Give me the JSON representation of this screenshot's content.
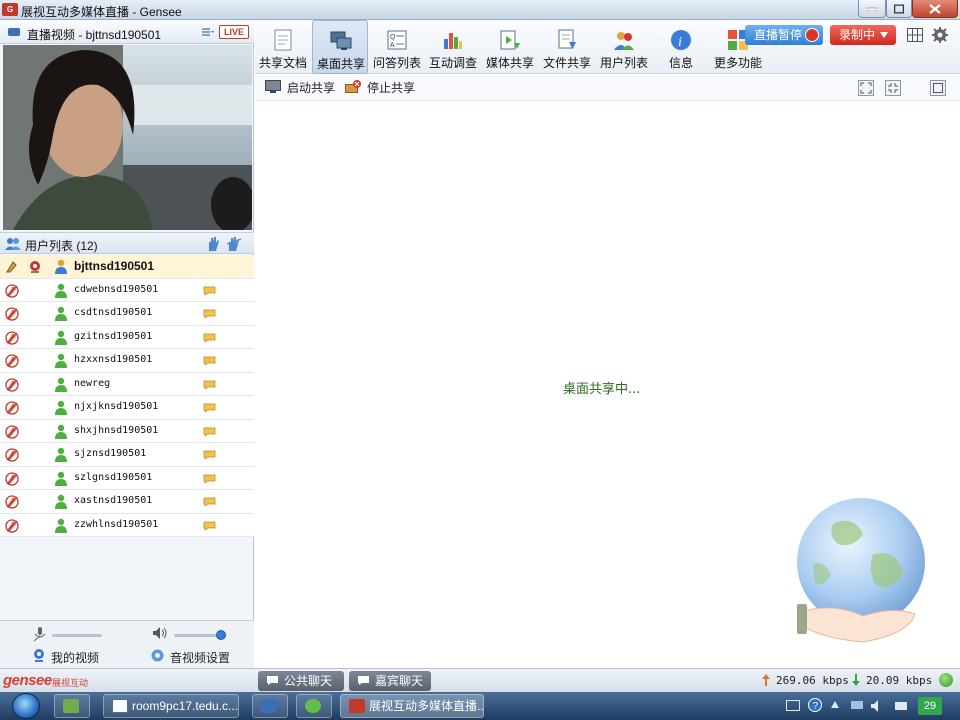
{
  "window": {
    "title": "展视互动多媒体直播 - Gensee"
  },
  "video": {
    "title": "直播视频 - bjttnsd190501",
    "live_badge": "LIVE"
  },
  "userlist": {
    "title": "用户列表 (12)",
    "users": [
      {
        "name": "bjttnsd190501",
        "self": true
      },
      {
        "name": "cdwebnsd190501"
      },
      {
        "name": "csdtnsd190501"
      },
      {
        "name": "gzitnsd190501"
      },
      {
        "name": "hzxxnsd190501"
      },
      {
        "name": "newreg"
      },
      {
        "name": "njxjknsd190501"
      },
      {
        "name": "shxjhnsd190501"
      },
      {
        "name": "sjznsd190501"
      },
      {
        "name": "szlgnsd190501"
      },
      {
        "name": "xastnsd190501"
      },
      {
        "name": "zzwhlnsd190501"
      }
    ]
  },
  "av_controls": {
    "my_video": "我的视频",
    "av_settings": "音视频设置",
    "speaker_level": 0.9
  },
  "toolbar": {
    "items": [
      {
        "label": "共享文档",
        "icon": "document-icon"
      },
      {
        "label": "桌面共享",
        "icon": "desktop-share-icon",
        "active": true
      },
      {
        "label": "问答列表",
        "icon": "qa-list-icon"
      },
      {
        "label": "互动调查",
        "icon": "survey-chart-icon"
      },
      {
        "label": "媒体共享",
        "icon": "media-share-icon"
      },
      {
        "label": "文件共享",
        "icon": "file-share-icon"
      },
      {
        "label": "用户列表",
        "icon": "users-icon"
      },
      {
        "label": "信息",
        "icon": "info-icon"
      },
      {
        "label": "更多功能",
        "icon": "more-functions-icon"
      }
    ],
    "pause_live": "直播暂停",
    "recording": "录制中"
  },
  "subtoolbar": {
    "start_share": "启动共享",
    "stop_share": "停止共享"
  },
  "content": {
    "status": "桌面共享中..."
  },
  "bottom": {
    "logo": "gensee",
    "logo_sub": "展视互动",
    "public_chat": "公共聊天",
    "guest_chat": "嘉宾聊天",
    "upload": "269.06 kbps",
    "download": "20.09 kbps"
  },
  "taskbar": {
    "room_window": "room9pc17.tedu.c...",
    "gensee_window": "展视互动多媒体直播...",
    "clock": "29"
  },
  "colors": {
    "accent_red": "#d6402f",
    "accent_blue": "#2f7fd4",
    "status_green": "#2e6b1f"
  }
}
